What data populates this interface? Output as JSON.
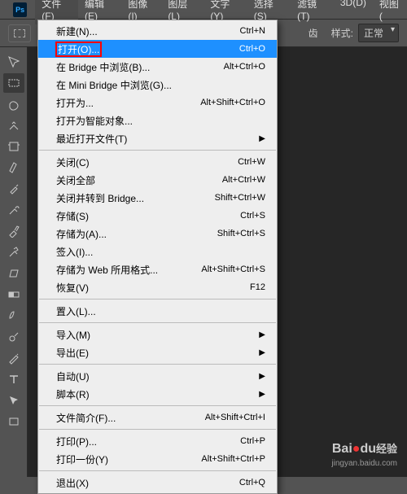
{
  "logo": "Ps",
  "menubar": [
    "文件(F)",
    "编辑(E)",
    "图像(I)",
    "图层(L)",
    "文字(Y)",
    "选择(S)",
    "滤镜(T)",
    "3D(D)",
    "视图("
  ],
  "menubar_active_index": 0,
  "options": {
    "partial_text": "齿",
    "style_label": "样式:",
    "style_value": "正常"
  },
  "toolbox_selected_index": 1,
  "file_menu": [
    {
      "type": "item",
      "label": "新建(N)...",
      "shortcut": "Ctrl+N"
    },
    {
      "type": "item",
      "label": "打开(O)...",
      "shortcut": "Ctrl+O",
      "highlighted": true
    },
    {
      "type": "item",
      "label": "在 Bridge 中浏览(B)...",
      "shortcut": "Alt+Ctrl+O"
    },
    {
      "type": "item",
      "label": "在 Mini Bridge 中浏览(G)..."
    },
    {
      "type": "item",
      "label": "打开为...",
      "shortcut": "Alt+Shift+Ctrl+O"
    },
    {
      "type": "item",
      "label": "打开为智能对象..."
    },
    {
      "type": "item",
      "label": "最近打开文件(T)",
      "submenu": true
    },
    {
      "type": "sep"
    },
    {
      "type": "item",
      "label": "关闭(C)",
      "shortcut": "Ctrl+W"
    },
    {
      "type": "item",
      "label": "关闭全部",
      "shortcut": "Alt+Ctrl+W"
    },
    {
      "type": "item",
      "label": "关闭并转到 Bridge...",
      "shortcut": "Shift+Ctrl+W"
    },
    {
      "type": "item",
      "label": "存储(S)",
      "shortcut": "Ctrl+S"
    },
    {
      "type": "item",
      "label": "存储为(A)...",
      "shortcut": "Shift+Ctrl+S"
    },
    {
      "type": "item",
      "label": "签入(I)..."
    },
    {
      "type": "item",
      "label": "存储为 Web 所用格式...",
      "shortcut": "Alt+Shift+Ctrl+S"
    },
    {
      "type": "item",
      "label": "恢复(V)",
      "shortcut": "F12"
    },
    {
      "type": "sep"
    },
    {
      "type": "item",
      "label": "置入(L)..."
    },
    {
      "type": "sep"
    },
    {
      "type": "item",
      "label": "导入(M)",
      "submenu": true
    },
    {
      "type": "item",
      "label": "导出(E)",
      "submenu": true
    },
    {
      "type": "sep"
    },
    {
      "type": "item",
      "label": "自动(U)",
      "submenu": true
    },
    {
      "type": "item",
      "label": "脚本(R)",
      "submenu": true
    },
    {
      "type": "sep"
    },
    {
      "type": "item",
      "label": "文件简介(F)...",
      "shortcut": "Alt+Shift+Ctrl+I"
    },
    {
      "type": "sep"
    },
    {
      "type": "item",
      "label": "打印(P)...",
      "shortcut": "Ctrl+P"
    },
    {
      "type": "item",
      "label": "打印一份(Y)",
      "shortcut": "Alt+Shift+Ctrl+P"
    },
    {
      "type": "sep"
    },
    {
      "type": "item",
      "label": "退出(X)",
      "shortcut": "Ctrl+Q"
    }
  ],
  "watermark": {
    "brand_a": "Bai",
    "brand_b": "du",
    "brand_c": "经验",
    "url": "jingyan.baidu.com"
  },
  "tool_names": [
    "move-tool",
    "marquee-tool",
    "lasso-tool",
    "quick-select-tool",
    "crop-tool",
    "eyedropper-tool",
    "healing-brush-tool",
    "brush-tool",
    "clone-stamp-tool",
    "history-brush-tool",
    "eraser-tool",
    "gradient-tool",
    "blur-tool",
    "dodge-tool",
    "pen-tool",
    "type-tool",
    "path-select-tool",
    "rectangle-tool"
  ]
}
